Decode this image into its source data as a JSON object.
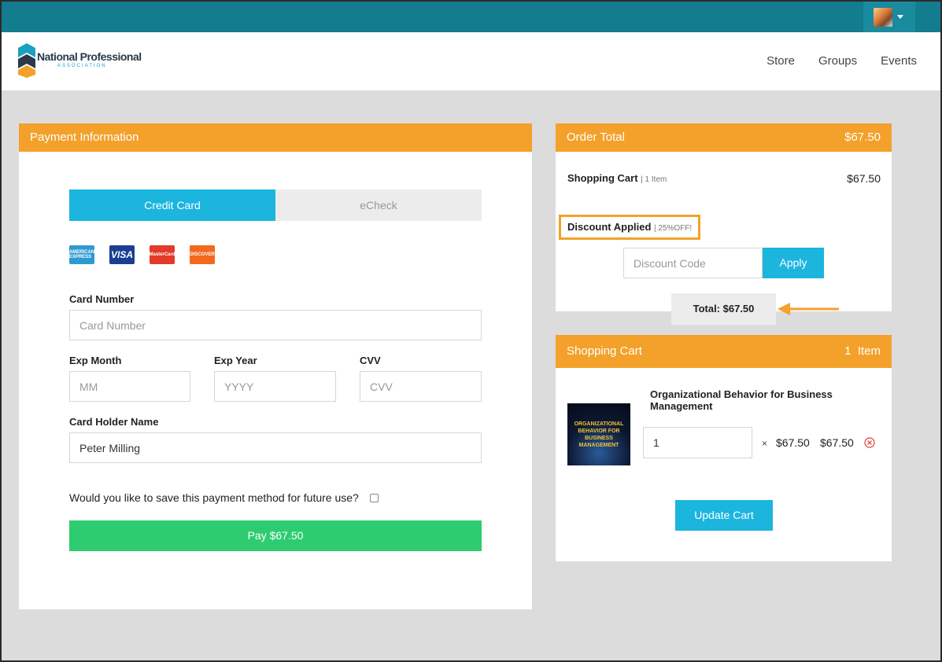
{
  "header": {
    "logo_text": "National Professional",
    "logo_sub": "ASSOCIATION",
    "nav": [
      "Store",
      "Groups",
      "Events"
    ]
  },
  "payment": {
    "title": "Payment Information",
    "tabs": [
      "Credit Card",
      "eCheck"
    ],
    "cards": [
      "AMERICAN EXPRESS",
      "VISA",
      "MasterCard",
      "DISCOVER"
    ],
    "card_number_label": "Card Number",
    "card_number_placeholder": "Card Number",
    "exp_month_label": "Exp Month",
    "exp_month_placeholder": "MM",
    "exp_year_label": "Exp Year",
    "exp_year_placeholder": "YYYY",
    "cvv_label": "CVV",
    "cvv_placeholder": "CVV",
    "holder_label": "Card Holder Name",
    "holder_value": "Peter Milling",
    "save_question": "Would you like to save this payment method for future use?",
    "pay_button": "Pay $67.50"
  },
  "order": {
    "title": "Order Total",
    "amount": "$67.50",
    "cart_label": "Shopping Cart",
    "cart_note": "| 1 Item",
    "cart_amount": "$67.50",
    "discount_label": "Discount Applied",
    "discount_note": "| 25%OFF!",
    "discount_placeholder": "Discount Code",
    "apply_button": "Apply",
    "total": "Total: $67.50"
  },
  "cart": {
    "title": "Shopping Cart",
    "count": "1  Item",
    "item_title": "Organizational Behavior for Business Management",
    "book_cover_text": "ORGANIZATIONAL BEHAVIOR FOR BUSINESS MANAGEMENT",
    "quantity": "1",
    "times": "×",
    "unit_price": "$67.50",
    "line_total": "$67.50",
    "update_button": "Update Cart"
  },
  "colors": {
    "topbar": "#137c8f",
    "accent_orange": "#f3a12a",
    "accent_blue": "#1bb5de",
    "pay_green": "#2ecc71"
  }
}
